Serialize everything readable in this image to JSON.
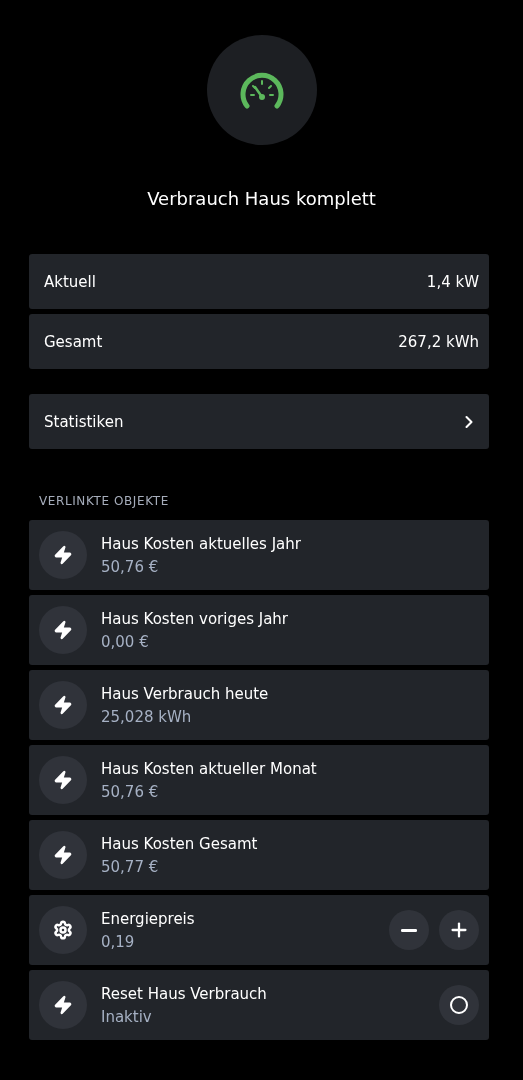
{
  "title": "Verbrauch Haus komplett",
  "values": [
    {
      "label": "Aktuell",
      "value": "1,4 kW"
    },
    {
      "label": "Gesamt",
      "value": "267,2 kWh"
    }
  ],
  "links": [
    {
      "label": "Statistiken"
    }
  ],
  "section_title": "VERLINKTE OBJEKTE",
  "objects": [
    {
      "kind": "value",
      "name": "Haus Kosten aktuelles Jahr",
      "value": "50,76 €"
    },
    {
      "kind": "value",
      "name": "Haus Kosten voriges Jahr",
      "value": "0,00 €"
    },
    {
      "kind": "value",
      "name": "Haus Verbrauch heute",
      "value": "25,028 kWh"
    },
    {
      "kind": "value",
      "name": "Haus Kosten aktueller Monat",
      "value": "50,76 €"
    },
    {
      "kind": "value",
      "name": "Haus Kosten Gesamt",
      "value": "50,77 €"
    },
    {
      "kind": "stepper",
      "name": "Energiepreis",
      "value": "0,19"
    },
    {
      "kind": "toggle",
      "name": "Reset Haus Verbrauch",
      "value": "Inaktiv",
      "on": false
    }
  ]
}
